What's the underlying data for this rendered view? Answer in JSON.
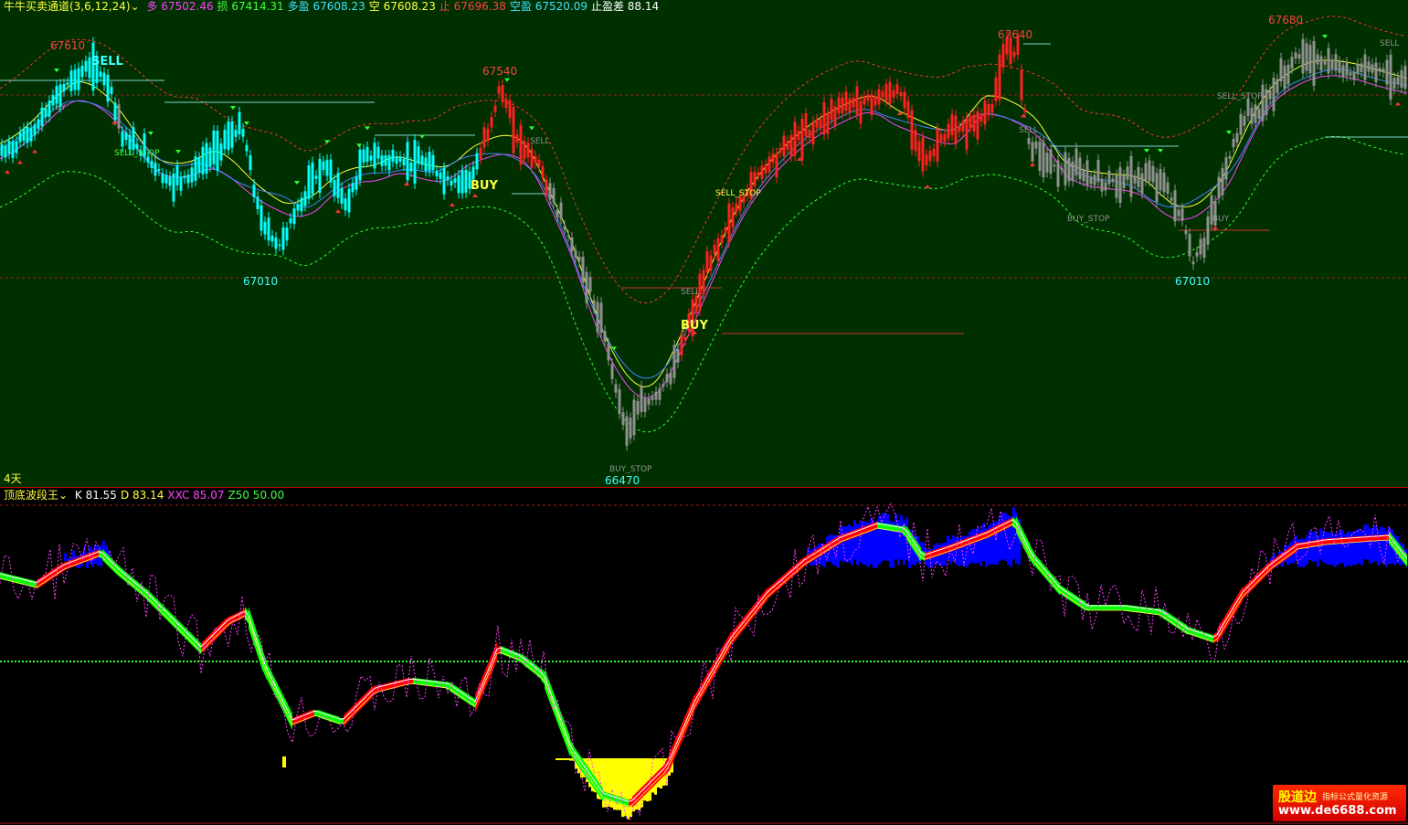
{
  "top_header": {
    "name": "牛牛买卖通道(3,6,12,24)",
    "items": [
      {
        "label": "多",
        "value": "67502.46",
        "color": "#ff40ff"
      },
      {
        "label": "损",
        "value": "67414.31",
        "color": "#40ff40"
      },
      {
        "label": "多盈",
        "value": "67608.23",
        "color": "#40e0ff"
      },
      {
        "label": "空",
        "value": "67608.23",
        "color": "#ffff40"
      },
      {
        "label": "止",
        "value": "67696.38",
        "color": "#ff4040"
      },
      {
        "label": "空盈",
        "value": "67520.09",
        "color": "#40e0ff"
      },
      {
        "label": "止盈差",
        "value": "88.14",
        "color": "#ffffff"
      }
    ]
  },
  "bottom_header": {
    "name": "顶底波段王",
    "items": [
      {
        "label": "K",
        "value": "81.55",
        "color": "#ffffff"
      },
      {
        "label": "D",
        "value": "83.14",
        "color": "#ffff40"
      },
      {
        "label": "XXC",
        "value": "85.07",
        "color": "#ff40ff"
      },
      {
        "label": "Z50",
        "value": "50.00",
        "color": "#40ff40"
      }
    ]
  },
  "period_label": "4天",
  "watermark": {
    "brand": "股道边",
    "tagline": "指标公式量化资源",
    "url": "www.de6688.com"
  },
  "chart_data": {
    "type": "candlestick",
    "price_labels": [
      {
        "text": "67610",
        "type": "high"
      },
      {
        "text": "67540",
        "type": "high"
      },
      {
        "text": "67640",
        "type": "high"
      },
      {
        "text": "67680",
        "type": "high"
      },
      {
        "text": "67010",
        "type": "low"
      },
      {
        "text": "66470",
        "type": "low"
      },
      {
        "text": "67010",
        "type": "low"
      }
    ],
    "signals": [
      {
        "text": "SELL",
        "style": "big"
      },
      {
        "text": "BUY",
        "style": "big"
      },
      {
        "text": "BUY",
        "style": "big"
      },
      {
        "text": "SELL",
        "style": "small"
      },
      {
        "text": "SELL",
        "style": "small"
      },
      {
        "text": "SELL",
        "style": "small"
      },
      {
        "text": "SELL",
        "style": "small"
      },
      {
        "text": "SELL_STOP",
        "style": "small"
      },
      {
        "text": "SELL_STOP",
        "style": "small"
      },
      {
        "text": "SELL_STOP",
        "style": "small"
      },
      {
        "text": "BUY_STOP",
        "style": "small"
      },
      {
        "text": "BUY_STOP",
        "style": "small"
      },
      {
        "text": "BUY",
        "style": "small"
      },
      {
        "text": "UY",
        "style": "small"
      }
    ],
    "bar_colors": {
      "up": "#ff2020",
      "down": "#00ffff",
      "neutral": "#909090"
    },
    "line_colors": {
      "upper_band": "#ff3030",
      "lower_band": "#30ff30",
      "ma_fast": "#ffff40",
      "ma_mid": "#ff40ff",
      "ma_slow": "#4080ff"
    },
    "oscillator": {
      "z50": 50,
      "k_last": 81.55,
      "d_last": 83.14,
      "xxc_last": 85.07
    }
  }
}
